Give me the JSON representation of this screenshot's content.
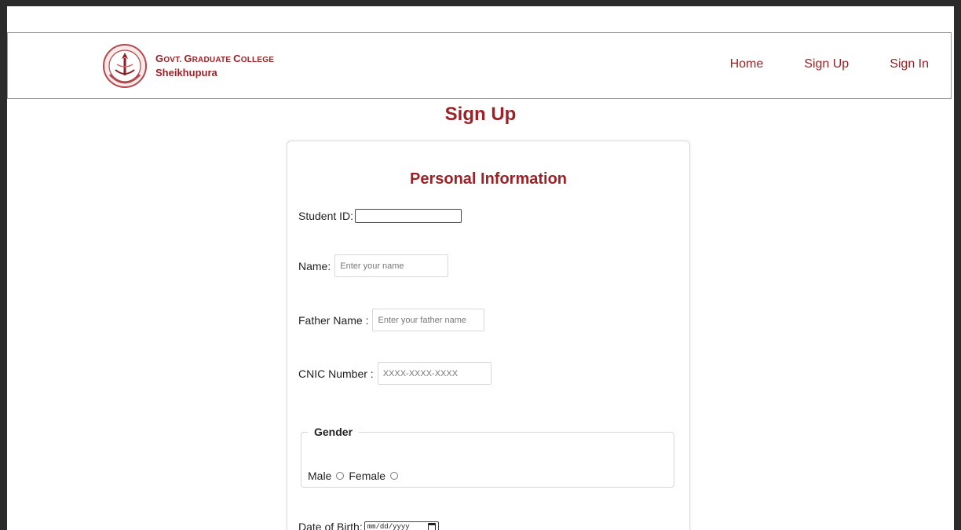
{
  "logo": {
    "line1_initials": [
      "G",
      "G",
      "C"
    ],
    "line1_rest": [
      "OVT. ",
      "RADUATE ",
      "OLLEGE"
    ],
    "line2": "Sheikhupura"
  },
  "nav": {
    "home": "Home",
    "signup": "Sign Up",
    "signin": "Sign In"
  },
  "page_title": "Sign Up",
  "section_title": "Personal Information",
  "fields": {
    "student_id_label": "Student ID:",
    "student_id_value": "",
    "name_label": "Name:",
    "name_placeholder": "Enter your name",
    "father_label": "Father Name :",
    "father_placeholder": "Enter your father name",
    "cnic_label": "CNIC Number :",
    "cnic_placeholder": "XXXX-XXXX-XXXX",
    "dob_label": "Date of Birth:",
    "dob_placeholder": "mm/dd/yyyy"
  },
  "gender": {
    "legend": "Gender",
    "male": "Male",
    "female": "Female"
  },
  "colors": {
    "accent": "#9b2226"
  },
  "icons": {
    "seal": "college-seal-icon",
    "calendar": "calendar-icon"
  }
}
